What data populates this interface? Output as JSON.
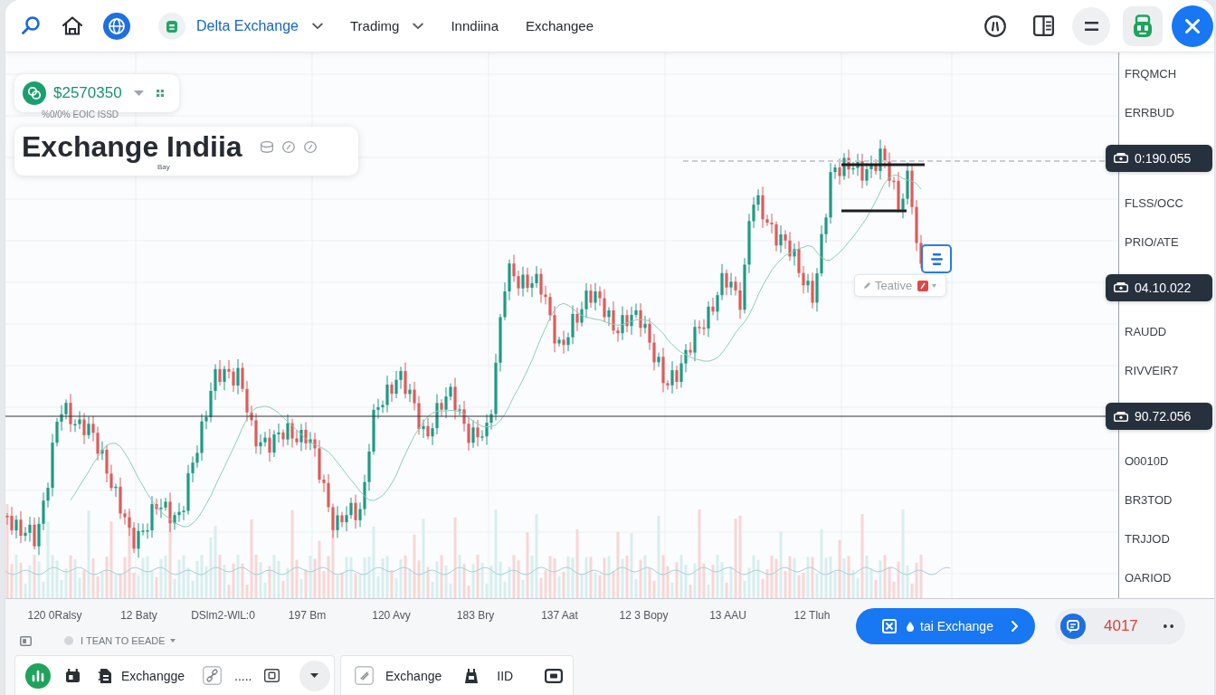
{
  "topbar": {
    "nav": [
      {
        "label": "Delta Exchange",
        "selected": true,
        "dropdown": true
      },
      {
        "label": "Tradimg",
        "selected": false,
        "dropdown": true
      },
      {
        "label": "Inndiina",
        "selected": false,
        "dropdown": false
      },
      {
        "label": "Exchangee",
        "selected": false,
        "dropdown": false
      }
    ]
  },
  "chart": {
    "price_badge": "$2570350",
    "subtitle": "%0/0% EOIC ISSD",
    "title": "Exchange Indiia",
    "title_note": "Bay",
    "tooltip": "Teative",
    "price_axis": [
      {
        "kind": "label",
        "text": "FRQMCH"
      },
      {
        "kind": "label",
        "text": "ERRBUD"
      },
      {
        "kind": "tag",
        "text": "0:190.055"
      },
      {
        "kind": "label",
        "text": "FLSS/OCC"
      },
      {
        "kind": "label",
        "text": "PRIO/ATE"
      },
      {
        "kind": "tag",
        "text": "04.10.022"
      },
      {
        "kind": "label",
        "text": "RAUDD"
      },
      {
        "kind": "label",
        "text": "RIVVEIR7"
      },
      {
        "kind": "tag",
        "text": "90.72.056"
      },
      {
        "kind": "label",
        "text": "O0010D"
      },
      {
        "kind": "label",
        "text": "BR3TOD"
      },
      {
        "kind": "label",
        "text": "TRJJOD"
      },
      {
        "kind": "label",
        "text": "OARIOD"
      }
    ],
    "time_axis": [
      "120 0Ralsy",
      "12 Baty",
      "DSlm2-WlL:0",
      "197 Bm",
      "120 Avy",
      "183 Bry",
      "137 Aat",
      "12 3 Bopy",
      "13 AAU",
      "12 Tluh"
    ]
  },
  "interval_dropdown": "I TEAN TO EEADE",
  "toolbar": {
    "group_1": [
      "Exchangge",
      "....."
    ],
    "group_2": [
      "Exchange",
      "IID"
    ]
  },
  "trade_button": "tai Exchange",
  "counter": "4017"
}
